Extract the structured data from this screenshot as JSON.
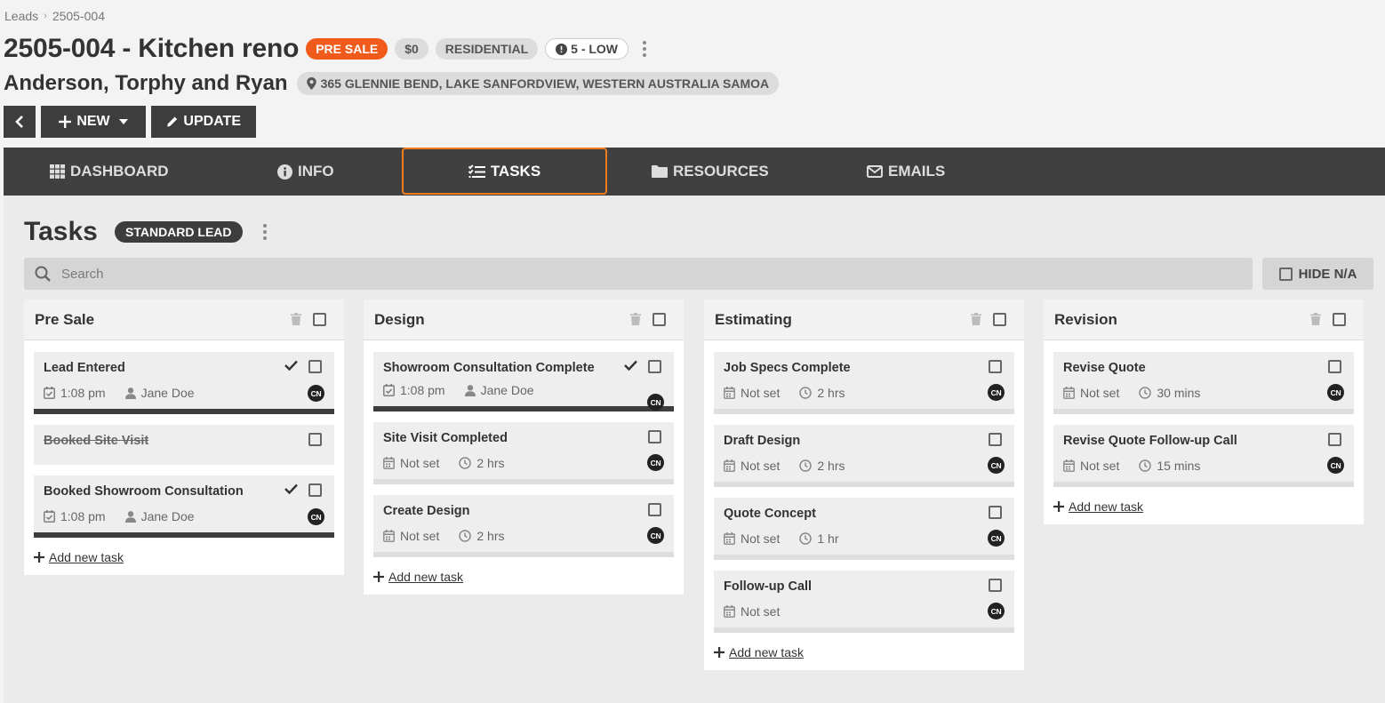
{
  "breadcrumb": {
    "root": "Leads",
    "current": "2505-004"
  },
  "header": {
    "title": "2505-004 - Kitchen reno",
    "status": "PRE SALE",
    "amount": "$0",
    "type": "RESIDENTIAL",
    "priority": "5 - LOW",
    "client": "Anderson, Torphy and Ryan",
    "address": "365 GLENNIE BEND, LAKE SANFORDVIEW, WESTERN AUSTRALIA SAMOA"
  },
  "buttons": {
    "new": "NEW",
    "update": "UPDATE"
  },
  "tabs": [
    {
      "label": "DASHBOARD",
      "icon": "grid-icon"
    },
    {
      "label": "INFO",
      "icon": "info-icon"
    },
    {
      "label": "TASKS",
      "icon": "task-list-icon"
    },
    {
      "label": "RESOURCES",
      "icon": "folder-icon"
    },
    {
      "label": "EMAILS",
      "icon": "envelope-icon"
    }
  ],
  "colors": {
    "accent": "#f05a1a",
    "tab_highlight": "#f07c1e",
    "dark": "#3d3d3d"
  },
  "tasks": {
    "title": "Tasks",
    "template": "STANDARD LEAD",
    "search_placeholder": "Search",
    "hide_na": "HIDE N/A",
    "add_new": "Add new task"
  },
  "columns": [
    {
      "title": "Pre Sale",
      "cards": [
        {
          "name": "Lead Entered",
          "date": "1:08 pm",
          "user": "Jane Doe",
          "avatar": "CN"
        },
        {
          "name": "Booked Site Visit"
        },
        {
          "name": "Booked Showroom Consultation",
          "date": "1:08 pm",
          "user": "Jane Doe",
          "avatar": "CN"
        }
      ]
    },
    {
      "title": "Design",
      "cards": [
        {
          "name": "Showroom Consultation Complete",
          "date": "1:08 pm",
          "user": "Jane Doe",
          "avatar": "CN"
        },
        {
          "name": "Site Visit Completed",
          "date": "Not set",
          "duration": "2 hrs",
          "avatar": "CN"
        },
        {
          "name": "Create Design",
          "date": "Not set",
          "duration": "2 hrs",
          "avatar": "CN"
        }
      ]
    },
    {
      "title": "Estimating",
      "cards": [
        {
          "name": "Job Specs Complete",
          "date": "Not set",
          "duration": "2 hrs",
          "avatar": "CN"
        },
        {
          "name": "Draft Design",
          "date": "Not set",
          "duration": "2 hrs",
          "avatar": "CN"
        },
        {
          "name": "Quote Concept",
          "date": "Not set",
          "duration": "1 hr",
          "avatar": "CN"
        },
        {
          "name": "Follow-up Call",
          "date": "Not set",
          "avatar": "CN"
        }
      ]
    },
    {
      "title": "Revision",
      "cards": [
        {
          "name": "Revise Quote",
          "date": "Not set",
          "duration": "30 mins",
          "avatar": "CN"
        },
        {
          "name": "Revise Quote Follow-up Call",
          "date": "Not set",
          "duration": "15 mins",
          "avatar": "CN"
        }
      ]
    }
  ]
}
